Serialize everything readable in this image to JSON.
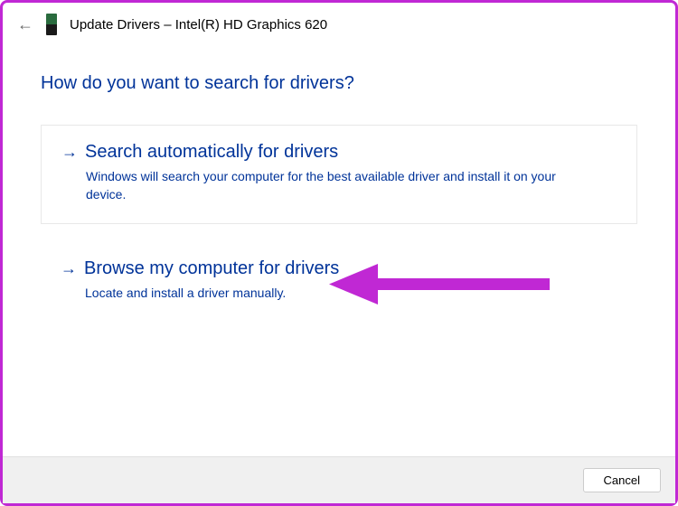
{
  "header": {
    "title": "Update Drivers – Intel(R) HD Graphics 620"
  },
  "main": {
    "heading": "How do you want to search for drivers?",
    "options": [
      {
        "title": "Search automatically for drivers",
        "description": "Windows will search your computer for the best available driver and install it on your device."
      },
      {
        "title": "Browse my computer for drivers",
        "description": "Locate and install a driver manually."
      }
    ]
  },
  "footer": {
    "cancel_label": "Cancel"
  }
}
